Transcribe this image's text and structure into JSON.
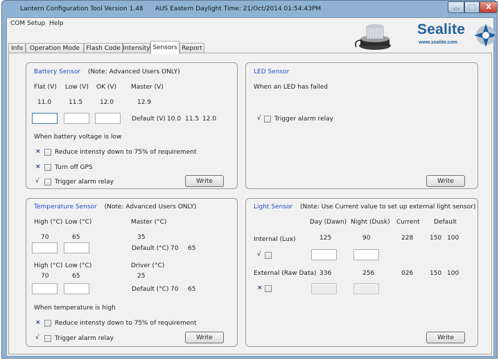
{
  "window": {
    "title": "Lantern Configuration Tool Version 1.48",
    "time_text": "AUS Eastern Daylight Time: 21/Oct/2014 01:54:43PM",
    "close_glyph": "X"
  },
  "menu": {
    "items": [
      "COM Setup",
      "Help"
    ]
  },
  "brand": {
    "name": "Sealite",
    "url": "www.sealite.com",
    "color": "#1f5f9d"
  },
  "tabs": [
    "Info",
    "Operation Mode",
    "Flash Code",
    "Intensity",
    "Sensors",
    "Report"
  ],
  "active_tab": "Sensors",
  "marks": {
    "checked": "√",
    "crossed": "×"
  },
  "write_label": "Write",
  "battery": {
    "title": "Battery Sensor",
    "note": "(Note: Advanced Users ONLY)",
    "headers": [
      "Flat (V)",
      "Low (V)",
      "OK (V)",
      "Master (V)"
    ],
    "values": [
      "11.0",
      "11.5",
      "12.0",
      "12.9"
    ],
    "default_label": "Default (V)",
    "defaults": [
      "10.0",
      "11.5",
      "12.0"
    ],
    "low_heading": "When battery voltage is low",
    "options": [
      "Reduce intensty down to 75% of requirement",
      "Turn off GPS",
      "Trigger alarm relay"
    ]
  },
  "led": {
    "title": "LED Sensor",
    "description": "When an LED has failed",
    "option": "Trigger alarm relay"
  },
  "temperature": {
    "title": "Temperature Sensor",
    "note": "(Note: Advanced Users ONLY)",
    "headers": [
      "High (°C)",
      "Low (°C)"
    ],
    "values": [
      "70",
      "65"
    ],
    "master_label": "Master (°C)",
    "master_value": "35",
    "default_label": "Default (°C)",
    "defaults": [
      "70",
      "65"
    ],
    "driver_label": "Driver (°C)",
    "driver_value": "25",
    "high_heading": "When temperature is high",
    "options": [
      "Reduce intensty down to 75% of requirement",
      "Trigger alarm relay"
    ]
  },
  "light": {
    "title": "Light Sensor",
    "note": "(Note: Use Current value to set up external light sensor)",
    "headers": [
      "Day (Dawn)",
      "Night (Dusk)",
      "Current",
      "Default"
    ],
    "internal": {
      "label": "Internal (Lux)",
      "day": "125",
      "night": "90",
      "current": "228",
      "defaults": [
        "150",
        "100"
      ]
    },
    "external": {
      "label": "External (Raw Data)",
      "day": "336",
      "night": "256",
      "current": "026",
      "defaults": [
        "150",
        "100"
      ]
    }
  }
}
